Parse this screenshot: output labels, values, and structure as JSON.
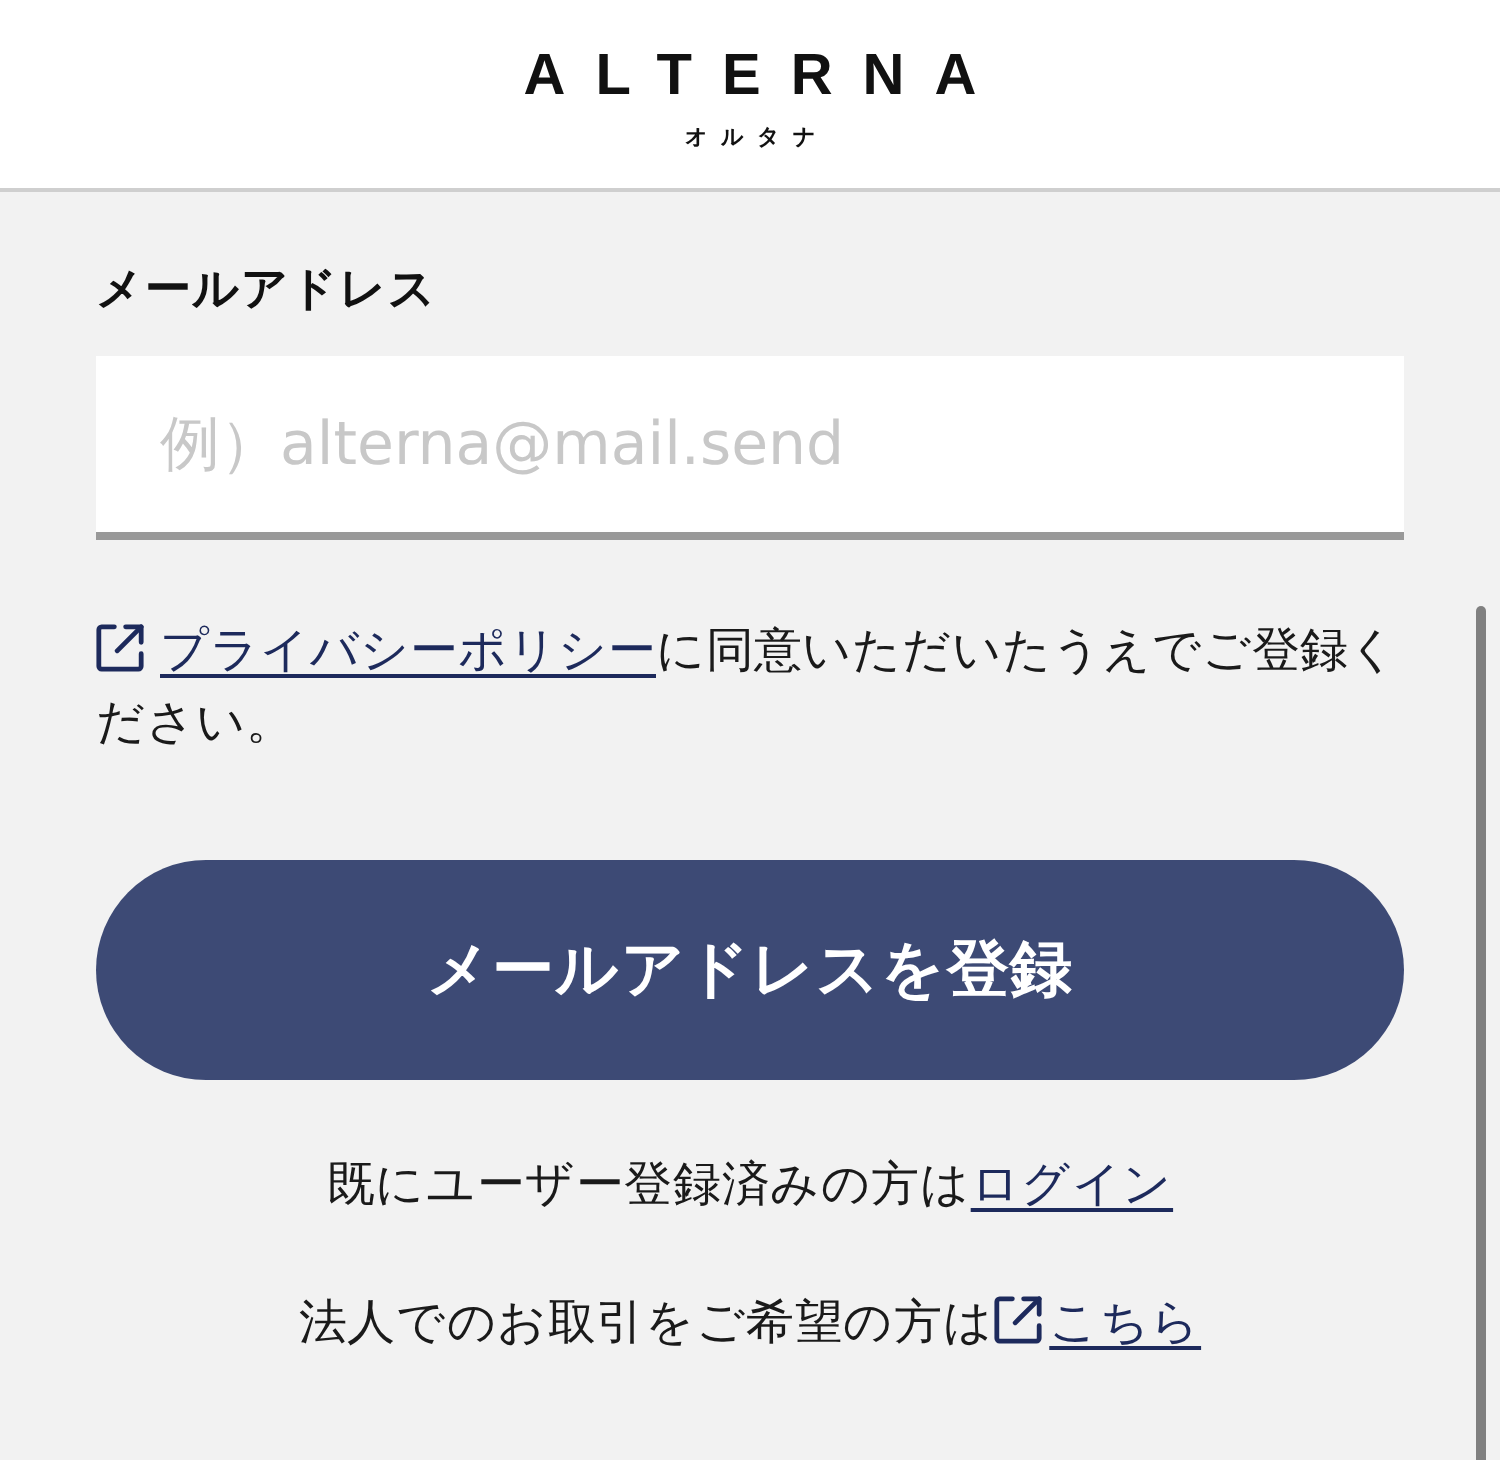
{
  "header": {
    "logo": "ALTERNA",
    "logo_kana": "オルタナ"
  },
  "form": {
    "email_label": "メールアドレス",
    "email_field": {
      "placeholder": "例）alterna@mail.send"
    },
    "consent": {
      "link": "プライバシーポリシー",
      "external": true,
      "text": "に同意いただいたうえでご登録ください。"
    },
    "submit_button": "メールアドレスを登録"
  },
  "links": [
    {
      "text": "既にユーザー登録済みの方は",
      "link": "ログイン",
      "external": false
    },
    {
      "text": "法人でのお取引をご希望の方は",
      "link": "こちら",
      "external": true
    }
  ]
}
